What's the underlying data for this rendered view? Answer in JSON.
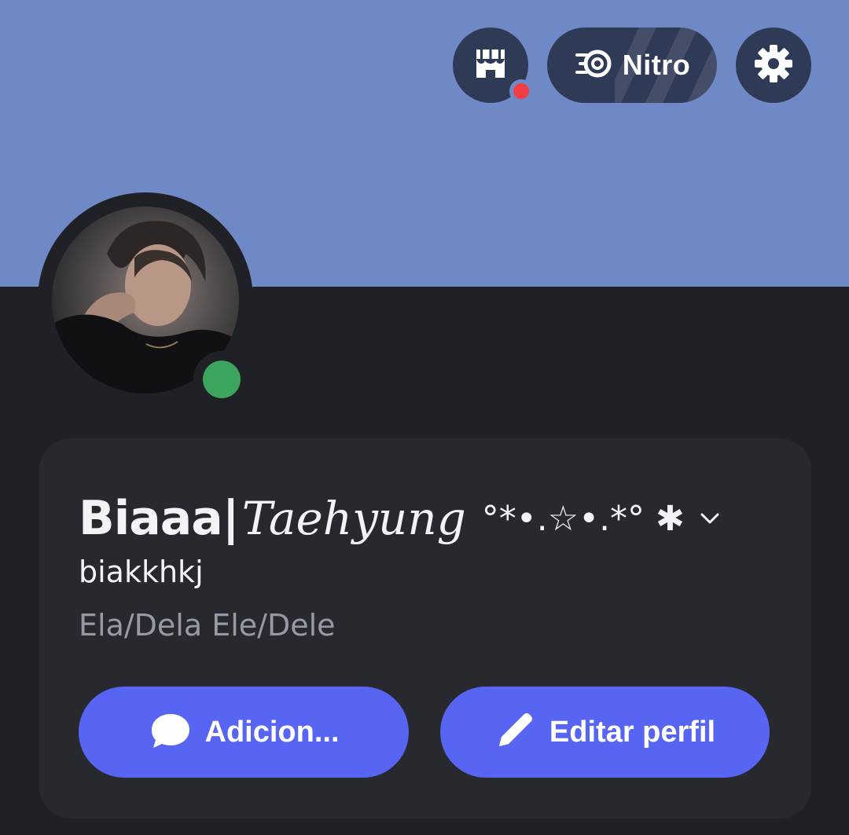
{
  "colors": {
    "banner": "#6f89c6",
    "background": "#202127",
    "card": "#28292f",
    "top_button": "#2f3a57",
    "accent_button": "#5865f2",
    "online_status": "#3ba55d",
    "notification_dot": "#f23f43",
    "text_primary": "#f2f3f5",
    "text_muted": "#949ba4"
  },
  "header": {
    "shop_icon": "shop-icon",
    "shop_has_notification": true,
    "nitro_icon": "nitro-icon",
    "nitro_label": "Nitro",
    "settings_icon": "gear-icon"
  },
  "profile": {
    "avatar_status": "online",
    "display_name_part1": "Biaaa|",
    "display_name_part2": "Taehyung",
    "display_name_decoration": "°*•.☆•.*° ✱",
    "username": "biakkhkj",
    "pronouns": "Ela/Dela Ele/Dele"
  },
  "actions": {
    "add_label": "Adicion...",
    "add_icon": "chat-bubble-icon",
    "edit_label": "Editar perfil",
    "edit_icon": "pencil-icon"
  }
}
